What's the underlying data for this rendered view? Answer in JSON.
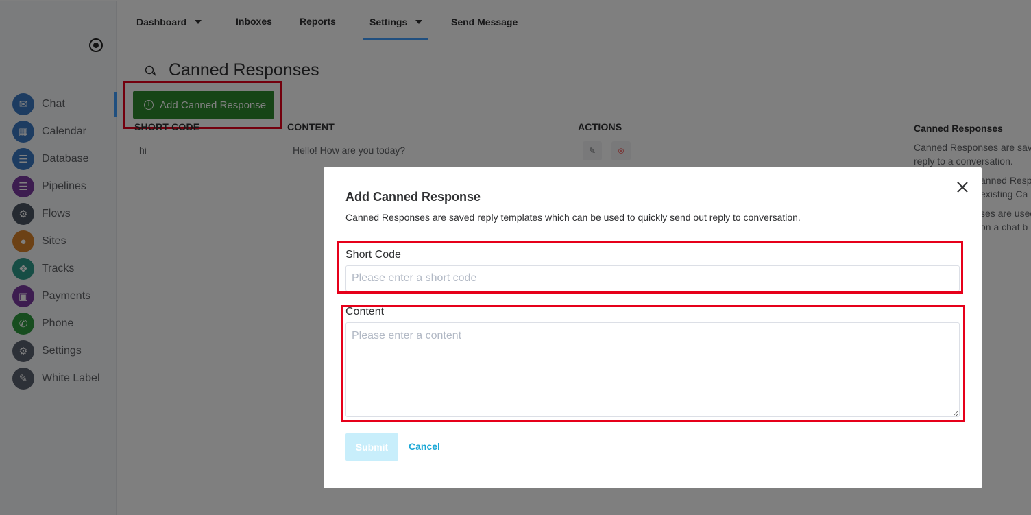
{
  "topnav": {
    "items": [
      {
        "label": "Dashboard",
        "dropdown": true
      },
      {
        "label": "Inboxes",
        "dropdown": false
      },
      {
        "label": "Reports",
        "dropdown": false
      },
      {
        "label": "Settings",
        "dropdown": true,
        "active": true
      },
      {
        "label": "Send Message",
        "dropdown": false
      }
    ]
  },
  "sidebar": {
    "items": [
      {
        "label": "Chat",
        "icon": "chat-icon",
        "color": "#3a78c2",
        "active": true
      },
      {
        "label": "Calendar",
        "icon": "calendar-icon",
        "color": "#3a78c2"
      },
      {
        "label": "Database",
        "icon": "database-icon",
        "color": "#3a78c2"
      },
      {
        "label": "Pipelines",
        "icon": "pipelines-icon",
        "color": "#7b3aa0"
      },
      {
        "label": "Flows",
        "icon": "flows-icon",
        "color": "#4a5563"
      },
      {
        "label": "Sites",
        "icon": "sites-icon",
        "color": "#d9822b"
      },
      {
        "label": "Tracks",
        "icon": "tracks-icon",
        "color": "#2f9a8a"
      },
      {
        "label": "Payments",
        "icon": "payments-icon",
        "color": "#7b3aa0"
      },
      {
        "label": "Phone",
        "icon": "phone-icon",
        "color": "#2e9b3e"
      },
      {
        "label": "Settings",
        "icon": "settings-icon",
        "color": "#5b6270"
      },
      {
        "label": "White Label",
        "icon": "white-label-icon",
        "color": "#5b6270"
      }
    ]
  },
  "page": {
    "title": "Canned Responses",
    "add_button_label": "Add Canned Response"
  },
  "table": {
    "headers": [
      "SHORT CODE",
      "CONTENT",
      "ACTIONS"
    ],
    "rows": [
      {
        "short_code": "hi",
        "content": "Hello! How are you today?"
      }
    ]
  },
  "info_panel": {
    "title": "Canned Responses",
    "line1": "Canned Responses are sav",
    "line2": "reply to a conversation.",
    "line3": "anned Resp",
    "line4": "existing Ca",
    "line5": "ses are used",
    "line6": "on a chat b"
  },
  "modal": {
    "title": "Add Canned Response",
    "description": "Canned Responses are saved reply templates which can be used to quickly send out reply to conversation.",
    "short_code_label": "Short Code",
    "short_code_placeholder": "Please enter a short code",
    "content_label": "Content",
    "content_placeholder": "Please enter a content",
    "submit_label": "Submit",
    "cancel_label": "Cancel"
  },
  "colors": {
    "primary_green": "#2e8b2e",
    "highlight_red": "#e6001a",
    "accent_blue": "#409eff",
    "cancel_link": "#1aa7d6",
    "submit_disabled": "#c8eefb"
  }
}
